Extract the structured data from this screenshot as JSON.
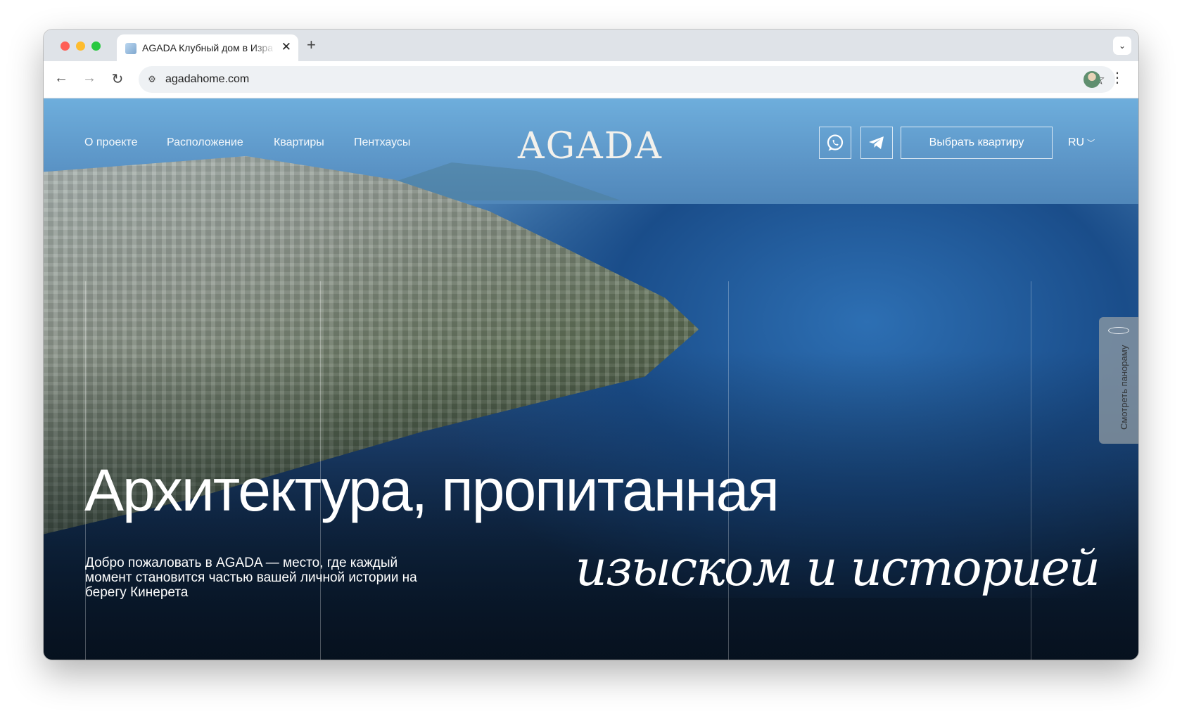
{
  "browser": {
    "tab": {
      "title": "AGADA Клубный дом в Изра"
    },
    "address_bar": {
      "url": "agadahome.com"
    }
  },
  "header": {
    "nav": [
      "О проекте",
      "Расположение",
      "Квартиры",
      "Пентхаусы"
    ],
    "logo_text": "AGADA",
    "cta_label": "Выбрать квартиру",
    "language": "RU"
  },
  "side_button": {
    "label": "Смотреть панораму",
    "icon_text": "360°"
  },
  "hero": {
    "title_line1": "Архитектура, пропитанная",
    "title_line2": "изыском и историей",
    "intro": "Добро пожаловать в AGADA — место, где каждый момент становится частью вашей личной истории на берегу Кинерета"
  },
  "icons": [
    "whatsapp-icon",
    "telegram-icon",
    "star-icon",
    "back-arrow-icon",
    "forward-arrow-icon",
    "reload-icon"
  ],
  "colors": {
    "sky": "#6eaedc",
    "sea": "#1d4477",
    "text": "#ffffff",
    "panorama_tab": "#969fa5"
  }
}
